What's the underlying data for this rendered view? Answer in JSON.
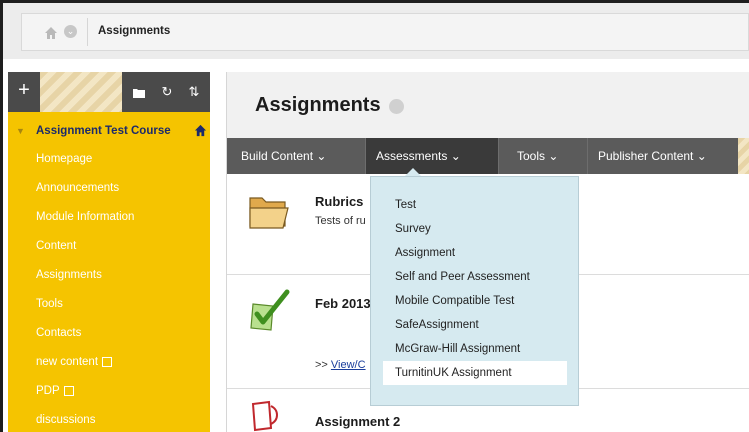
{
  "breadcrumb": {
    "label": "Assignments"
  },
  "sidebar": {
    "course_title": "Assignment Test Course",
    "items": [
      {
        "label": "Homepage"
      },
      {
        "label": "Announcements"
      },
      {
        "label": "Module Information"
      },
      {
        "label": "Content"
      },
      {
        "label": "Assignments"
      },
      {
        "label": "Tools"
      },
      {
        "label": "Contacts"
      },
      {
        "label": "new content"
      },
      {
        "label": "PDP"
      },
      {
        "label": "discussions"
      }
    ]
  },
  "page": {
    "title": "Assignments"
  },
  "toolbar": {
    "build_content": "Build Content",
    "assessments": "Assessments",
    "tools": "Tools",
    "publisher_content": "Publisher Content"
  },
  "menu": {
    "items": [
      "Test",
      "Survey",
      "Assignment",
      "Self and Peer Assessment",
      "Mobile Compatible Test",
      "SafeAssignment",
      "McGraw-Hill Assignment",
      "TurnitinUK Assignment"
    ]
  },
  "content": {
    "item1": {
      "title": "Rubrics",
      "text": "Tests of ru"
    },
    "item2": {
      "title": "Feb 2013",
      "link_prefix": ">> ",
      "link": "View/C"
    },
    "item3": {
      "title": "Assignment 2"
    }
  }
}
